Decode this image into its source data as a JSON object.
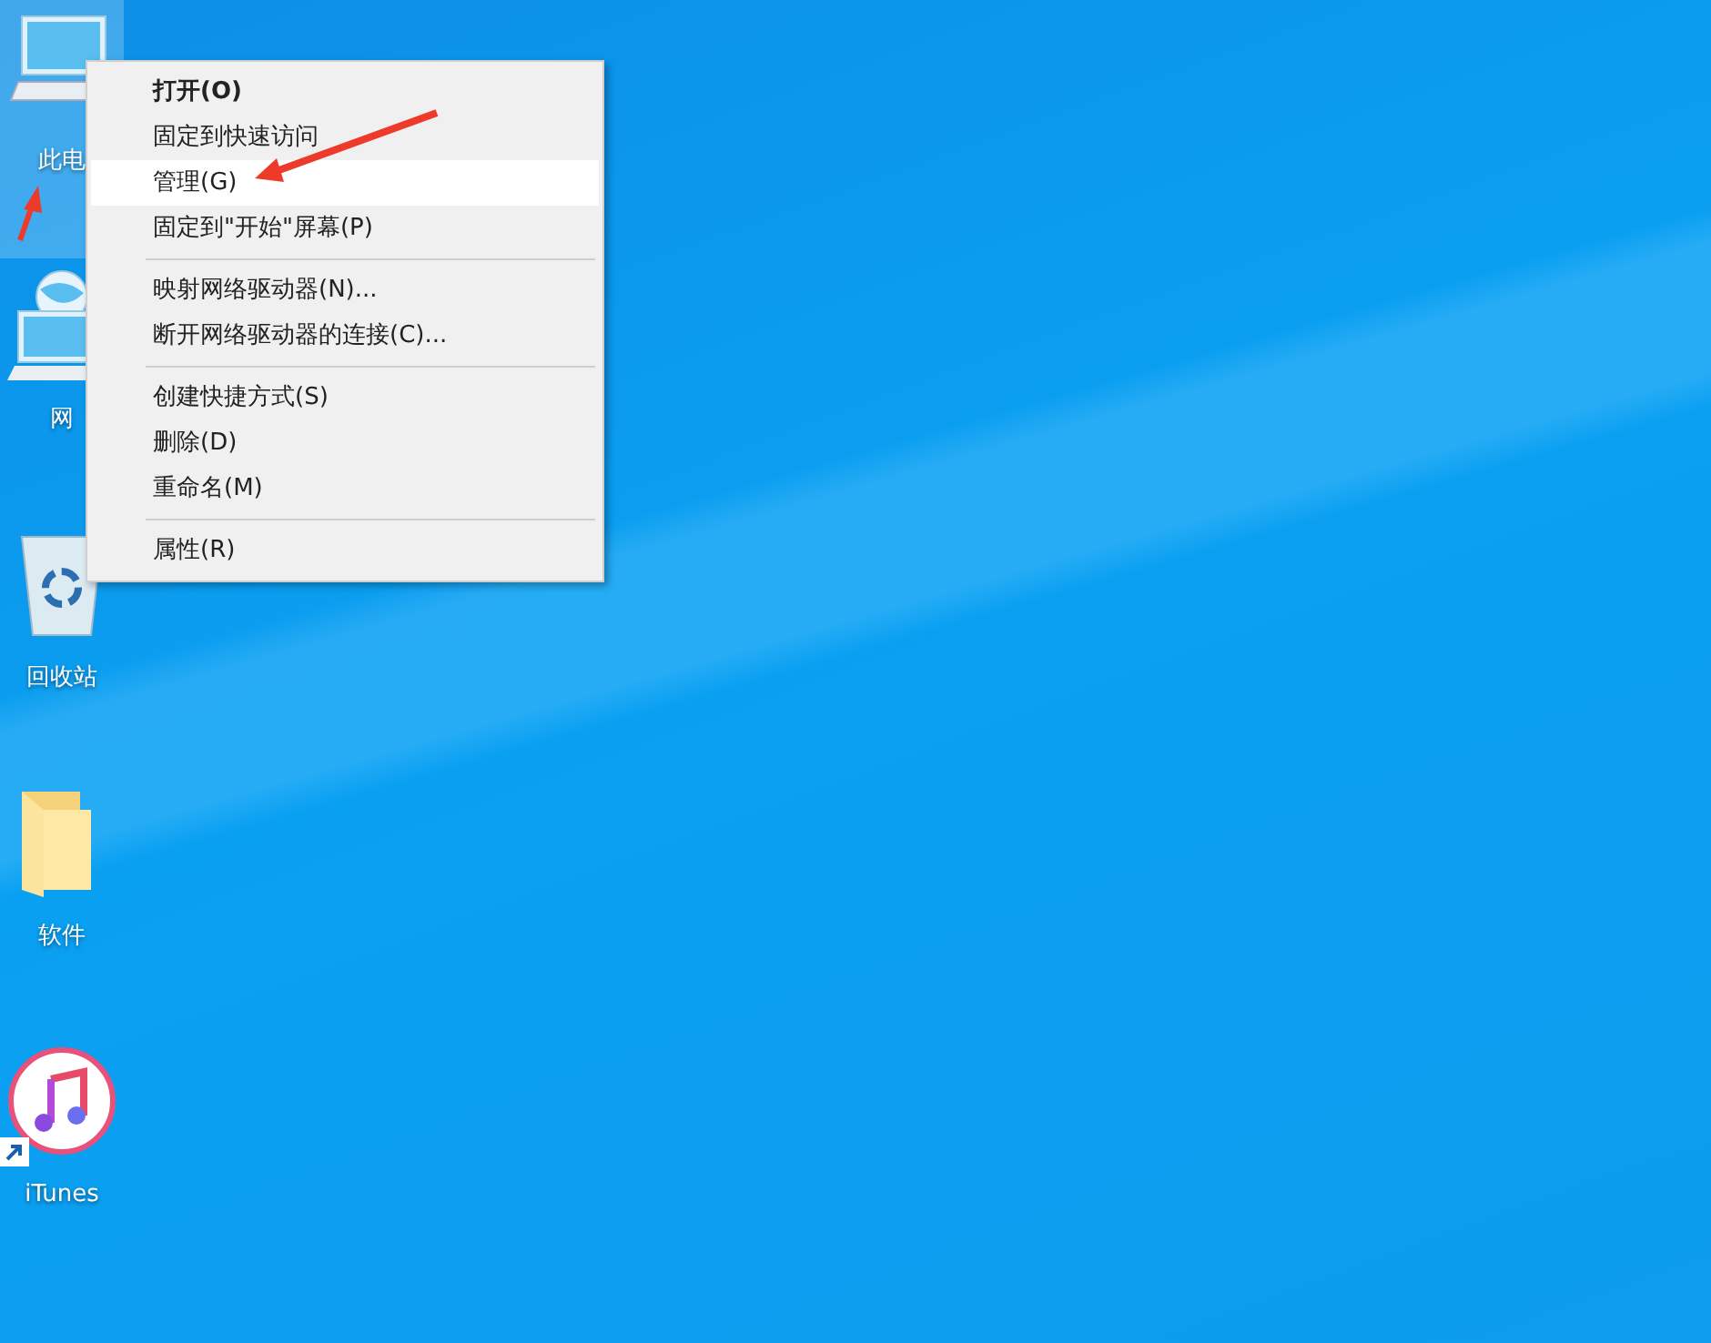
{
  "desktop_icons": [
    {
      "kind": "computer",
      "label": "此电",
      "selected": true,
      "shortcut": false
    },
    {
      "kind": "network",
      "label": "网",
      "selected": false,
      "shortcut": false
    },
    {
      "kind": "recycle-bin",
      "label": "回收站",
      "selected": false,
      "shortcut": false
    },
    {
      "kind": "folder",
      "label": "软件",
      "selected": false,
      "shortcut": false
    },
    {
      "kind": "itunes",
      "label": "iTunes",
      "selected": false,
      "shortcut": true
    }
  ],
  "context_menu": {
    "items": [
      {
        "kind": "item",
        "label": "打开(O)",
        "default": true,
        "selected": false
      },
      {
        "kind": "item",
        "label": "固定到快速访问",
        "default": false,
        "selected": false
      },
      {
        "kind": "item",
        "label": "管理(G)",
        "default": false,
        "selected": true
      },
      {
        "kind": "item",
        "label": "固定到\"开始\"屏幕(P)",
        "default": false,
        "selected": false
      },
      {
        "kind": "separator"
      },
      {
        "kind": "item",
        "label": "映射网络驱动器(N)...",
        "default": false,
        "selected": false
      },
      {
        "kind": "item",
        "label": "断开网络驱动器的连接(C)...",
        "default": false,
        "selected": false
      },
      {
        "kind": "separator"
      },
      {
        "kind": "item",
        "label": "创建快捷方式(S)",
        "default": false,
        "selected": false
      },
      {
        "kind": "item",
        "label": "删除(D)",
        "default": false,
        "selected": false
      },
      {
        "kind": "item",
        "label": "重命名(M)",
        "default": false,
        "selected": false
      },
      {
        "kind": "separator"
      },
      {
        "kind": "item",
        "label": "属性(R)",
        "default": false,
        "selected": false
      }
    ]
  }
}
